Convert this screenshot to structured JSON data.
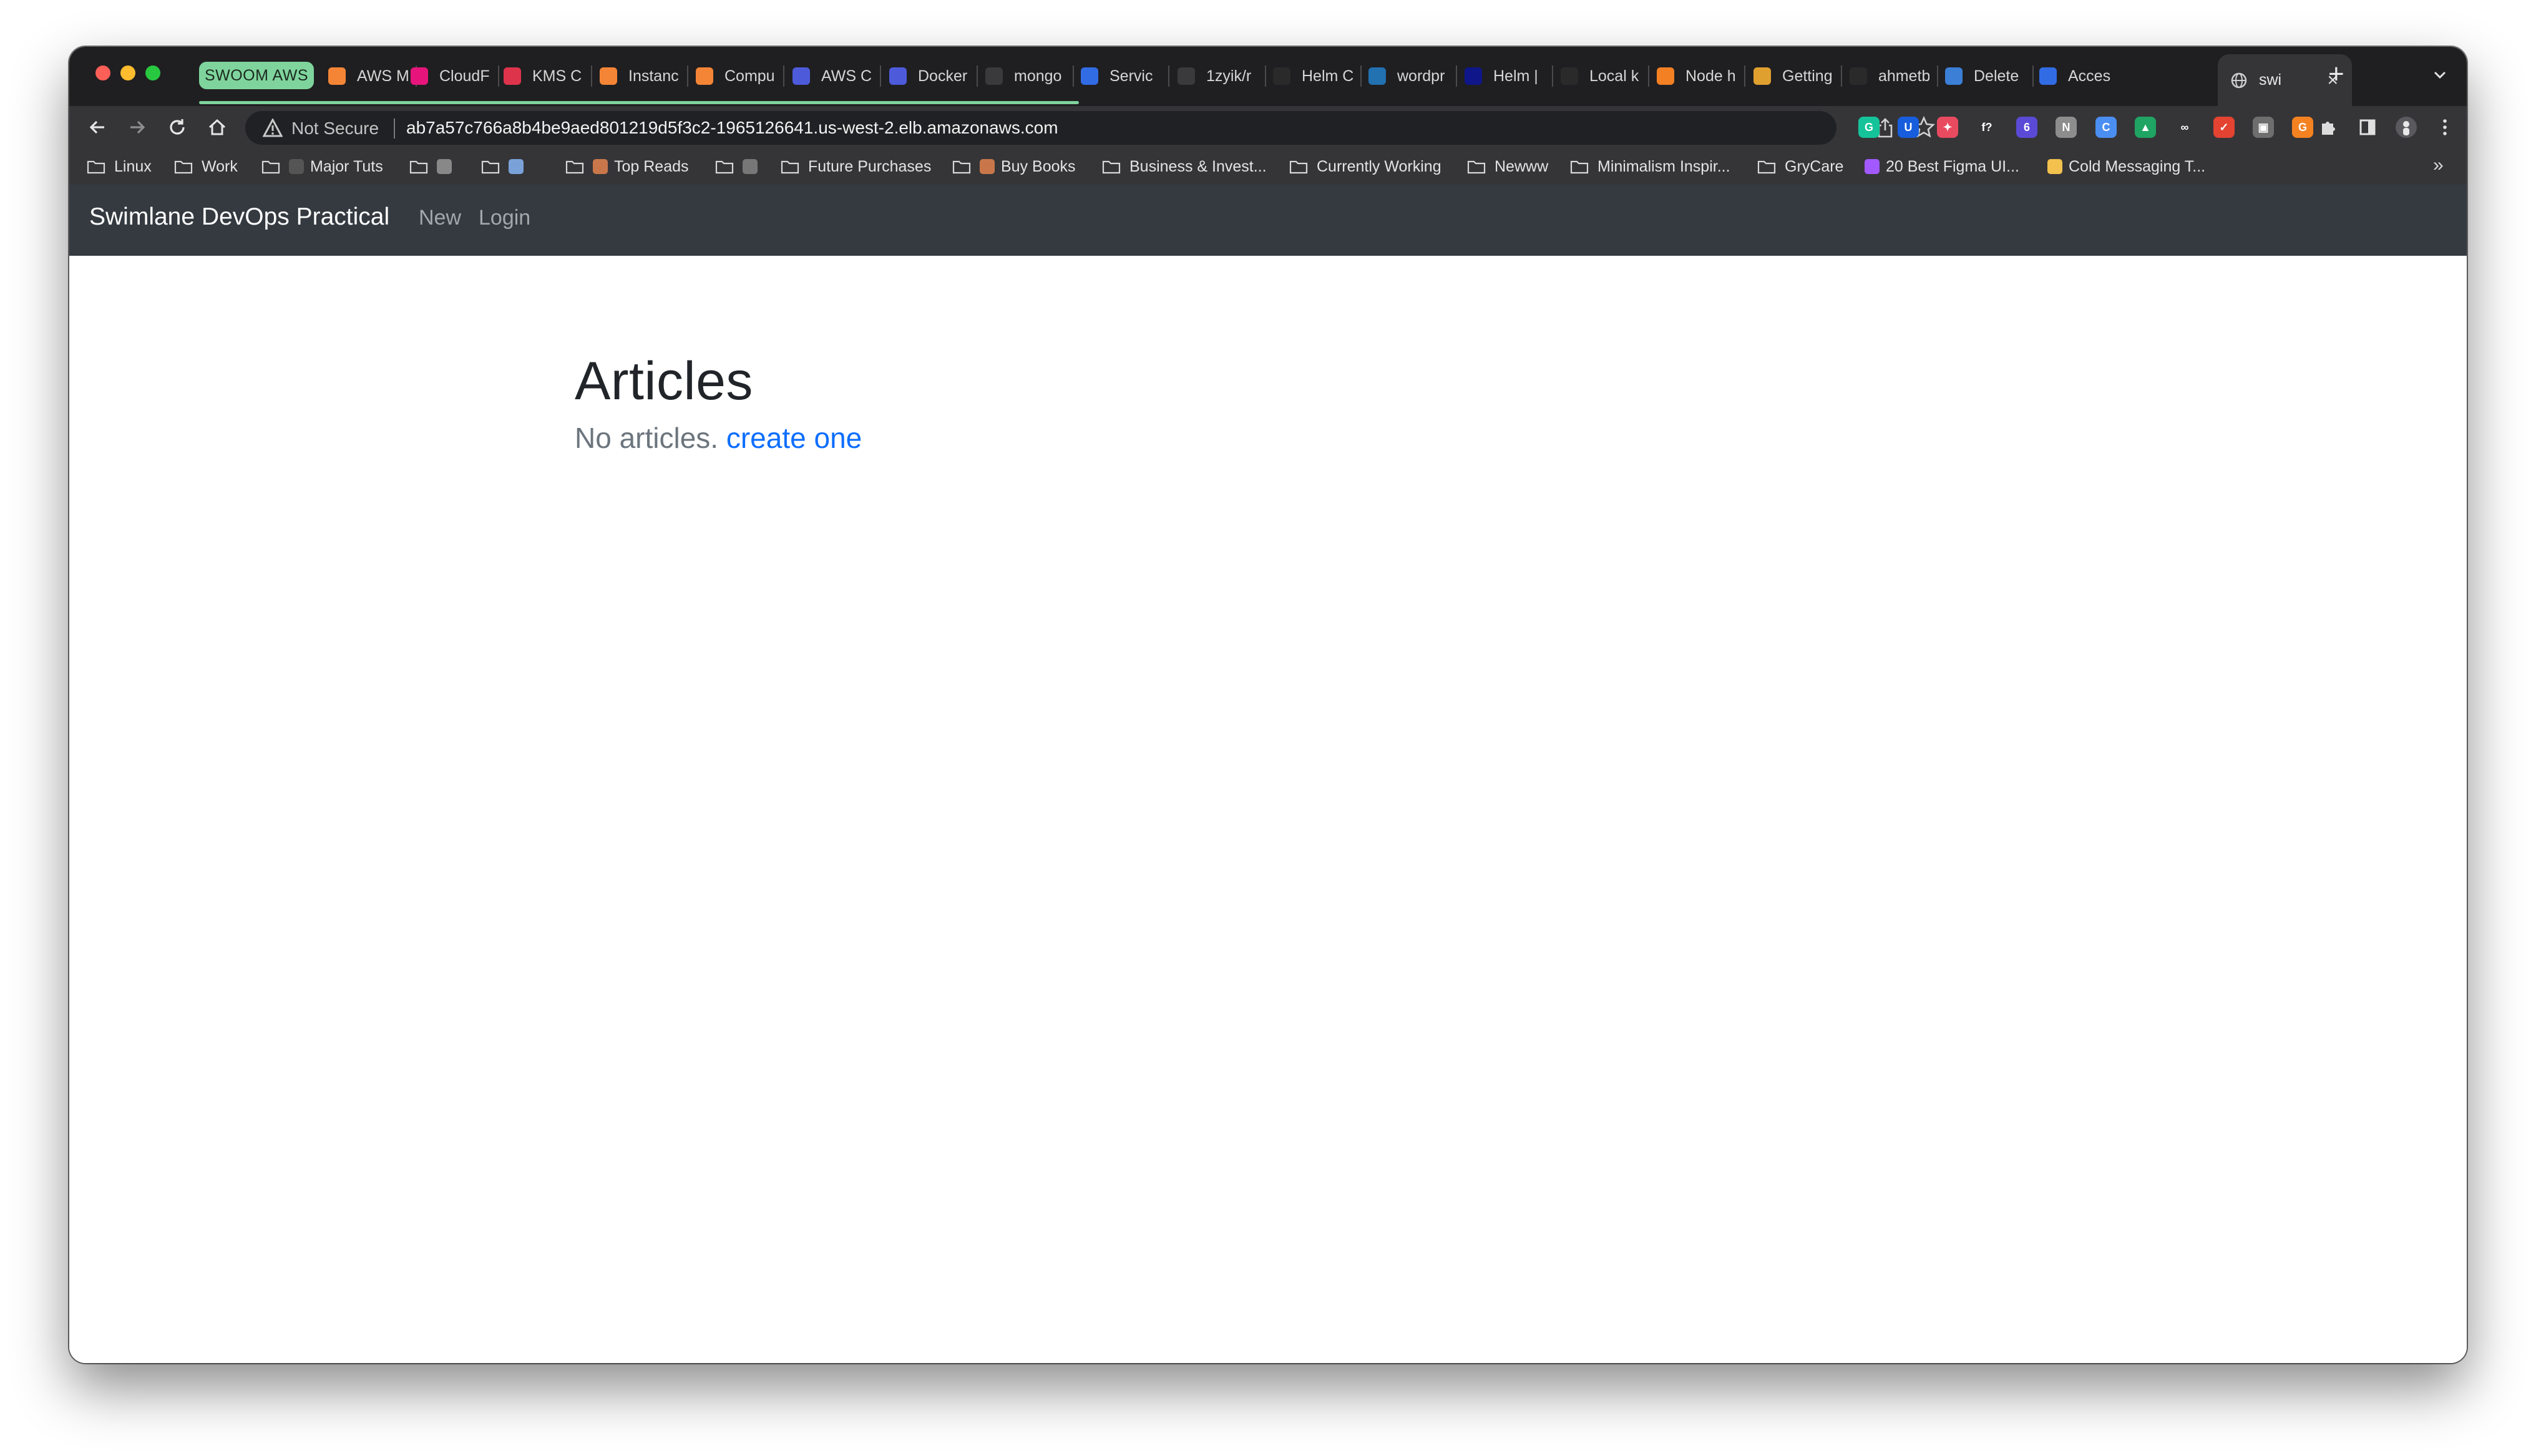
{
  "browser": {
    "tab_group_label": "SWOOM AWS",
    "tabs": [
      {
        "title": "AWS M",
        "icon": "aws-icon",
        "color": "#f58536"
      },
      {
        "title": "CloudF",
        "icon": "cloudfront-icon",
        "color": "#e7157b"
      },
      {
        "title": "KMS C",
        "icon": "kms-icon",
        "color": "#dd344c"
      },
      {
        "title": "Instanc",
        "icon": "ec2-icon",
        "color": "#f58536"
      },
      {
        "title": "Compu",
        "icon": "compute-icon",
        "color": "#f58536"
      },
      {
        "title": "AWS C",
        "icon": "aws-console-icon",
        "color": "#4d5bdb"
      },
      {
        "title": "Docker",
        "icon": "docker-icon",
        "color": "#4d5bdb"
      },
      {
        "title": "mongo",
        "icon": "mongo-icon",
        "color": "#3a3a3d"
      },
      {
        "title": "Servic",
        "icon": "kubernetes-icon",
        "color": "#326ce5"
      },
      {
        "title": "1zyik/r",
        "icon": "link-icon",
        "color": "#3a3a3d"
      },
      {
        "title": "Helm C",
        "icon": "medium-icon",
        "color": "#2a2a2a"
      },
      {
        "title": "wordpr",
        "icon": "wordpress-icon",
        "color": "#2271b1"
      },
      {
        "title": "Helm |",
        "icon": "helm-icon",
        "color": "#0f1689"
      },
      {
        "title": "Local k",
        "icon": "github-icon",
        "color": "#2a2a2a"
      },
      {
        "title": "Node h",
        "icon": "stackoverflow-icon",
        "color": "#f48024"
      },
      {
        "title": "Getting",
        "icon": "package-icon",
        "color": "#e0a030"
      },
      {
        "title": "ahmetb",
        "icon": "github-icon",
        "color": "#2a2a2a"
      },
      {
        "title": "Delete",
        "icon": "digitalocean-icon",
        "color": "#3b7fd6"
      },
      {
        "title": "Acces",
        "icon": "kubernetes-icon",
        "color": "#326ce5"
      }
    ],
    "active_tab": {
      "title": "swi",
      "icon": "globe-icon"
    },
    "address_bar": {
      "security_label": "Not Secure",
      "url": "ab7a57c766a8b4be9aed801219d5f3c2-1965126641.us-west-2.elb.amazonaws.com"
    },
    "extensions": [
      {
        "icon": "grammarly-icon",
        "color": "#15c39a",
        "glyph": "G"
      },
      {
        "icon": "bitwarden-icon",
        "color": "#175ddc",
        "glyph": "U"
      },
      {
        "icon": "colorpicker-icon",
        "color": "#e84a5f",
        "glyph": "✦"
      },
      {
        "icon": "fontface-icon",
        "color": "#353538",
        "glyph": "f?"
      },
      {
        "icon": "multi-account-icon",
        "color": "#5b4ad6",
        "glyph": "6"
      },
      {
        "icon": "notion-icon",
        "color": "#8d8d8d",
        "glyph": "N"
      },
      {
        "icon": "sync-icon",
        "color": "#4a8ef1",
        "glyph": "C"
      },
      {
        "icon": "google-drive-icon",
        "color": "#1fa463",
        "glyph": "▲"
      },
      {
        "icon": "glasses-icon",
        "color": "#353538",
        "glyph": "∞"
      },
      {
        "icon": "todoist-icon",
        "color": "#e44332",
        "glyph": "✓"
      },
      {
        "icon": "camera-icon",
        "color": "#6e6e6e",
        "glyph": "▣"
      },
      {
        "icon": "honey-icon",
        "color": "#f58220",
        "glyph": "G"
      },
      {
        "icon": "pocket-icon",
        "color": "#ef3f56",
        "glyph": "♥"
      }
    ],
    "bookmarks": [
      {
        "label": "Linux",
        "type": "folder"
      },
      {
        "label": "Work",
        "type": "folder"
      },
      {
        "label": "Major Tuts",
        "type": "folder",
        "emoji": "bomb"
      },
      {
        "label": "",
        "type": "folder",
        "emoji": "tools"
      },
      {
        "label": "",
        "type": "folder",
        "emoji": "calendar"
      },
      {
        "label": "Top Reads",
        "type": "folder",
        "emoji": "books"
      },
      {
        "label": "",
        "type": "folder",
        "emoji": "gamepad"
      },
      {
        "label": "Future Purchases",
        "type": "folder"
      },
      {
        "label": "Buy Books",
        "type": "folder",
        "emoji": "books"
      },
      {
        "label": "Business & Invest...",
        "type": "folder"
      },
      {
        "label": "Currently Working",
        "type": "folder"
      },
      {
        "label": "Newww",
        "type": "folder"
      },
      {
        "label": "Minimalism Inspir...",
        "type": "folder"
      },
      {
        "label": "GryCare",
        "type": "folder"
      },
      {
        "label": "20 Best Figma UI...",
        "type": "link",
        "emoji": "figma"
      },
      {
        "label": "Cold Messaging T...",
        "type": "link",
        "emoji": "handshake"
      }
    ],
    "bookmarks_overflow": "»"
  },
  "site": {
    "brand": "Swimlane DevOps Practical",
    "nav_links": [
      "New",
      "Login"
    ],
    "heading": "Articles",
    "empty_text": "No articles.",
    "create_link": "create one"
  },
  "colors": {
    "navbar_bg": "#343a40",
    "link": "#0d6efd",
    "tab_group": "#7fd49d"
  }
}
